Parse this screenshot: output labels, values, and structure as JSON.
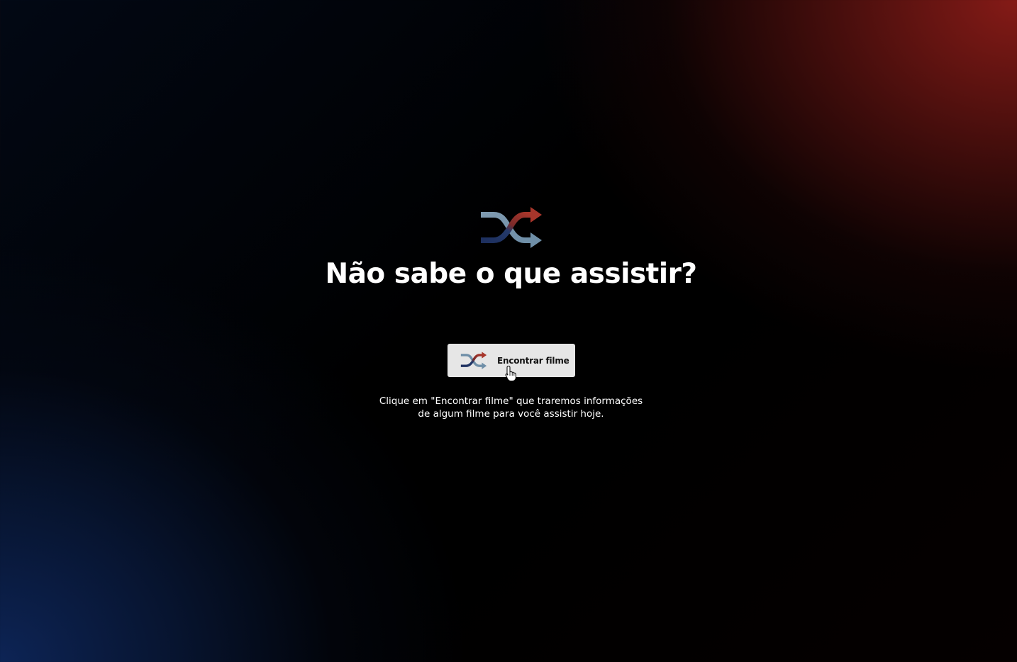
{
  "hero": {
    "logo_icon": "shuffle-icon",
    "title": "Não sabe o que assistir?",
    "button": {
      "icon": "shuffle-icon",
      "label": "Encontrar filme"
    },
    "description_lines": [
      "Clique em \"Encontrar filme\" que traremos informações",
      "de algum filme para você assistir hoje."
    ]
  },
  "colors": {
    "accent_red": "#a8362b",
    "accent_blue": "#6f8fa8",
    "accent_navy": "#1f3566",
    "button_bg": "#e6e6e6",
    "text": "#ffffff"
  }
}
